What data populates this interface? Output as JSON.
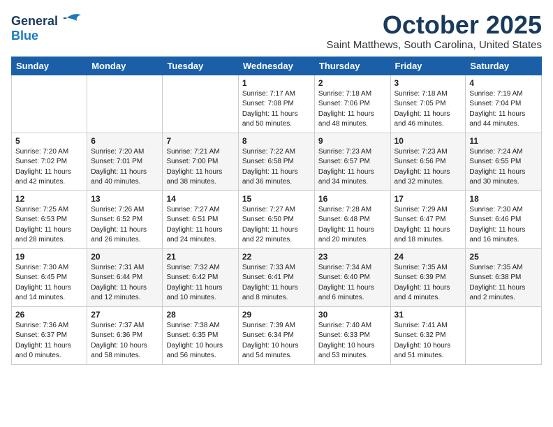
{
  "logo": {
    "general": "General",
    "blue": "Blue"
  },
  "title": "October 2025",
  "location": "Saint Matthews, South Carolina, United States",
  "days_of_week": [
    "Sunday",
    "Monday",
    "Tuesday",
    "Wednesday",
    "Thursday",
    "Friday",
    "Saturday"
  ],
  "weeks": [
    [
      {
        "day": "",
        "content": ""
      },
      {
        "day": "",
        "content": ""
      },
      {
        "day": "",
        "content": ""
      },
      {
        "day": "1",
        "content": "Sunrise: 7:17 AM\nSunset: 7:08 PM\nDaylight: 11 hours\nand 50 minutes."
      },
      {
        "day": "2",
        "content": "Sunrise: 7:18 AM\nSunset: 7:06 PM\nDaylight: 11 hours\nand 48 minutes."
      },
      {
        "day": "3",
        "content": "Sunrise: 7:18 AM\nSunset: 7:05 PM\nDaylight: 11 hours\nand 46 minutes."
      },
      {
        "day": "4",
        "content": "Sunrise: 7:19 AM\nSunset: 7:04 PM\nDaylight: 11 hours\nand 44 minutes."
      }
    ],
    [
      {
        "day": "5",
        "content": "Sunrise: 7:20 AM\nSunset: 7:02 PM\nDaylight: 11 hours\nand 42 minutes."
      },
      {
        "day": "6",
        "content": "Sunrise: 7:20 AM\nSunset: 7:01 PM\nDaylight: 11 hours\nand 40 minutes."
      },
      {
        "day": "7",
        "content": "Sunrise: 7:21 AM\nSunset: 7:00 PM\nDaylight: 11 hours\nand 38 minutes."
      },
      {
        "day": "8",
        "content": "Sunrise: 7:22 AM\nSunset: 6:58 PM\nDaylight: 11 hours\nand 36 minutes."
      },
      {
        "day": "9",
        "content": "Sunrise: 7:23 AM\nSunset: 6:57 PM\nDaylight: 11 hours\nand 34 minutes."
      },
      {
        "day": "10",
        "content": "Sunrise: 7:23 AM\nSunset: 6:56 PM\nDaylight: 11 hours\nand 32 minutes."
      },
      {
        "day": "11",
        "content": "Sunrise: 7:24 AM\nSunset: 6:55 PM\nDaylight: 11 hours\nand 30 minutes."
      }
    ],
    [
      {
        "day": "12",
        "content": "Sunrise: 7:25 AM\nSunset: 6:53 PM\nDaylight: 11 hours\nand 28 minutes."
      },
      {
        "day": "13",
        "content": "Sunrise: 7:26 AM\nSunset: 6:52 PM\nDaylight: 11 hours\nand 26 minutes."
      },
      {
        "day": "14",
        "content": "Sunrise: 7:27 AM\nSunset: 6:51 PM\nDaylight: 11 hours\nand 24 minutes."
      },
      {
        "day": "15",
        "content": "Sunrise: 7:27 AM\nSunset: 6:50 PM\nDaylight: 11 hours\nand 22 minutes."
      },
      {
        "day": "16",
        "content": "Sunrise: 7:28 AM\nSunset: 6:48 PM\nDaylight: 11 hours\nand 20 minutes."
      },
      {
        "day": "17",
        "content": "Sunrise: 7:29 AM\nSunset: 6:47 PM\nDaylight: 11 hours\nand 18 minutes."
      },
      {
        "day": "18",
        "content": "Sunrise: 7:30 AM\nSunset: 6:46 PM\nDaylight: 11 hours\nand 16 minutes."
      }
    ],
    [
      {
        "day": "19",
        "content": "Sunrise: 7:30 AM\nSunset: 6:45 PM\nDaylight: 11 hours\nand 14 minutes."
      },
      {
        "day": "20",
        "content": "Sunrise: 7:31 AM\nSunset: 6:44 PM\nDaylight: 11 hours\nand 12 minutes."
      },
      {
        "day": "21",
        "content": "Sunrise: 7:32 AM\nSunset: 6:42 PM\nDaylight: 11 hours\nand 10 minutes."
      },
      {
        "day": "22",
        "content": "Sunrise: 7:33 AM\nSunset: 6:41 PM\nDaylight: 11 hours\nand 8 minutes."
      },
      {
        "day": "23",
        "content": "Sunrise: 7:34 AM\nSunset: 6:40 PM\nDaylight: 11 hours\nand 6 minutes."
      },
      {
        "day": "24",
        "content": "Sunrise: 7:35 AM\nSunset: 6:39 PM\nDaylight: 11 hours\nand 4 minutes."
      },
      {
        "day": "25",
        "content": "Sunrise: 7:35 AM\nSunset: 6:38 PM\nDaylight: 11 hours\nand 2 minutes."
      }
    ],
    [
      {
        "day": "26",
        "content": "Sunrise: 7:36 AM\nSunset: 6:37 PM\nDaylight: 11 hours\nand 0 minutes."
      },
      {
        "day": "27",
        "content": "Sunrise: 7:37 AM\nSunset: 6:36 PM\nDaylight: 10 hours\nand 58 minutes."
      },
      {
        "day": "28",
        "content": "Sunrise: 7:38 AM\nSunset: 6:35 PM\nDaylight: 10 hours\nand 56 minutes."
      },
      {
        "day": "29",
        "content": "Sunrise: 7:39 AM\nSunset: 6:34 PM\nDaylight: 10 hours\nand 54 minutes."
      },
      {
        "day": "30",
        "content": "Sunrise: 7:40 AM\nSunset: 6:33 PM\nDaylight: 10 hours\nand 53 minutes."
      },
      {
        "day": "31",
        "content": "Sunrise: 7:41 AM\nSunset: 6:32 PM\nDaylight: 10 hours\nand 51 minutes."
      },
      {
        "day": "",
        "content": ""
      }
    ]
  ]
}
